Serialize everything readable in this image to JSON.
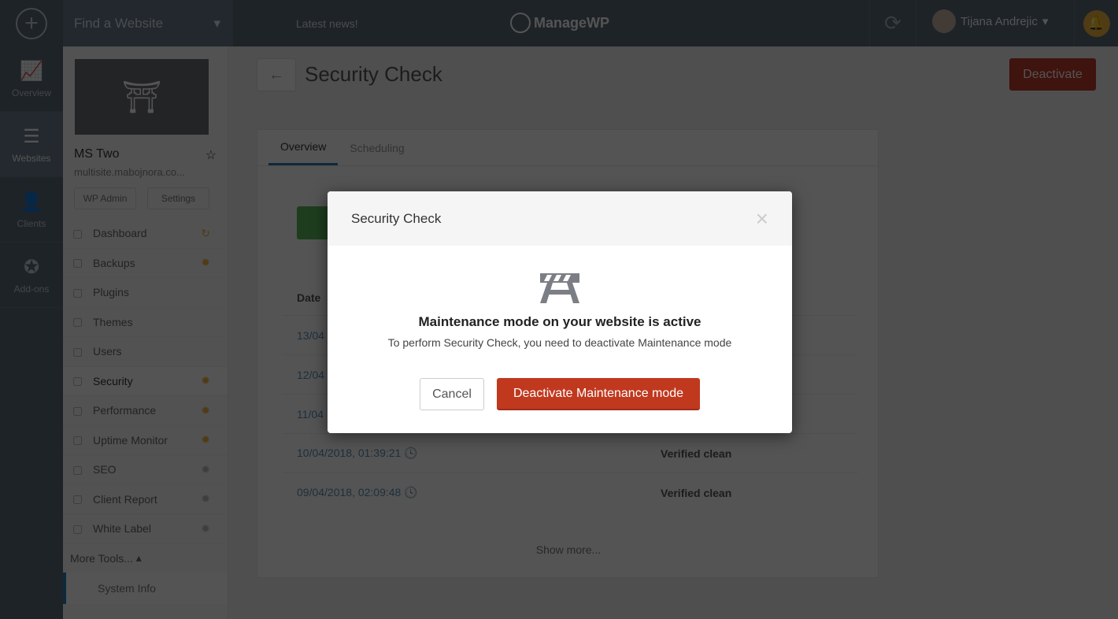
{
  "topbar": {
    "find_label": "Find a Website",
    "news": "Latest news!",
    "logo": "ManageWP",
    "user": "Tijana Andrejic"
  },
  "leftnav": [
    {
      "label": "Overview",
      "icon": "chart-monitor-icon"
    },
    {
      "label": "Websites",
      "icon": "websites-icon"
    },
    {
      "label": "Clients",
      "icon": "clients-icon"
    },
    {
      "label": "Add-ons",
      "icon": "star-badge-icon"
    }
  ],
  "site": {
    "name": "MS Two",
    "url": "multisite.mabojnora.co...",
    "wp_admin": "WP Admin",
    "settings": "Settings"
  },
  "menu": [
    {
      "label": "Dashboard",
      "right": "↻"
    },
    {
      "label": "Backups",
      "right": "✹"
    },
    {
      "label": "Plugins",
      "right": ""
    },
    {
      "label": "Themes",
      "right": ""
    },
    {
      "label": "Users",
      "right": ""
    },
    {
      "label": "Security",
      "right": "✹"
    },
    {
      "label": "Performance",
      "right": "✹"
    },
    {
      "label": "Uptime Monitor",
      "right": "✹"
    },
    {
      "label": "SEO",
      "right": "✹"
    },
    {
      "label": "Client Report",
      "right": "✹"
    },
    {
      "label": "White Label",
      "right": "✹"
    }
  ],
  "more_tools": "More Tools...",
  "system_info": "System Info",
  "main": {
    "title": "Security Check",
    "deactivate": "Deactivate",
    "tabs": [
      "Overview",
      "Scheduling"
    ],
    "date_header": "Date",
    "rows": [
      {
        "date": "13/04",
        "status": ""
      },
      {
        "date": "12/04",
        "status": ""
      },
      {
        "date": "11/04",
        "status": ""
      },
      {
        "date": "10/04/2018, 01:39:21",
        "status": "Verified clean"
      },
      {
        "date": "09/04/2018, 02:09:48",
        "status": "Verified clean"
      }
    ],
    "show_more": "Show more..."
  },
  "modal": {
    "title": "Security Check",
    "heading": "Maintenance mode on your website is active",
    "text": "To perform Security Check, you need to deactivate Maintenance mode",
    "cancel": "Cancel",
    "confirm": "Deactivate Maintenance mode"
  },
  "colors": {
    "accent": "#c0391f",
    "nav": "#2f3a45",
    "tab": "#2b7bb9"
  }
}
